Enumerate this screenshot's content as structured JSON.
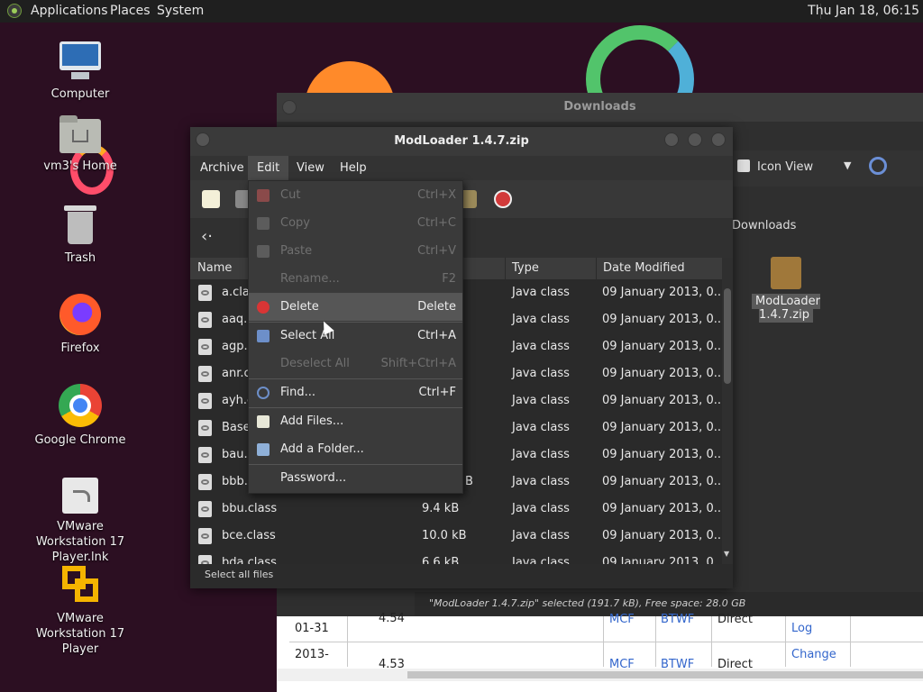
{
  "top_panel": {
    "menus": [
      "Applications",
      "Places",
      "System"
    ],
    "clock": "Thu Jan 18, 06:15"
  },
  "desktop_icons": [
    {
      "label": "Computer",
      "icon": "computer-icon"
    },
    {
      "label": "vm3's Home",
      "icon": "home-folder-icon"
    },
    {
      "label": "Trash",
      "icon": "trash-icon"
    },
    {
      "label": "Firefox",
      "icon": "firefox-icon"
    },
    {
      "label": "Google Chrome",
      "icon": "chrome-icon"
    },
    {
      "label": "VMware Workstation 17 Player.lnk",
      "icon": "shortcut-icon"
    },
    {
      "label": "VMware Workstation 17 Player",
      "icon": "vmware-icon"
    }
  ],
  "downloads_window": {
    "title": "Downloads",
    "view_mode": "Icon View",
    "path": "Downloads",
    "file_label": "ModLoader 1.4.7.zip",
    "status": "\"ModLoader 1.4.7.zip\" selected (191.7 kB), Free space: 28.0 GB"
  },
  "archive_window": {
    "title": "ModLoader 1.4.7.zip",
    "menus": [
      "Archive",
      "Edit",
      "View",
      "Help"
    ],
    "columns": {
      "name": "Name",
      "type": "Type",
      "date": "Date Modified"
    },
    "rows": [
      {
        "name": "a.clas",
        "size": "",
        "type": "Java class",
        "date": "09 January 2013, 0..."
      },
      {
        "name": "aaq.c",
        "size": "",
        "type": "Java class",
        "date": "09 January 2013, 0..."
      },
      {
        "name": "agp.c",
        "size": "",
        "type": "Java class",
        "date": "09 January 2013, 0..."
      },
      {
        "name": "anr.c",
        "size": "",
        "type": "Java class",
        "date": "09 January 2013, 0..."
      },
      {
        "name": "ayh.c",
        "size": "",
        "type": "Java class",
        "date": "09 January 2013, 0..."
      },
      {
        "name": "Base",
        "size": "",
        "type": "Java class",
        "date": "09 January 2013, 0..."
      },
      {
        "name": "bau.c",
        "size": "",
        "type": "Java class",
        "date": "09 January 2013, 0..."
      },
      {
        "name": "bbb.c",
        "size": "B",
        "type": "Java class",
        "date": "09 January 2013, 0..."
      },
      {
        "name": "bbu.class",
        "size": "9.4 kB",
        "type": "Java class",
        "date": "09 January 2013, 0..."
      },
      {
        "name": "bce.class",
        "size": "10.0 kB",
        "type": "Java class",
        "date": "09 January 2013, 0..."
      },
      {
        "name": "bda.class",
        "size": "6.6 kB",
        "type": "Java class",
        "date": "09 January 2013, 0..."
      }
    ],
    "status": "Select all files"
  },
  "edit_menu": [
    {
      "label": "Cut",
      "shortcut": "Ctrl+X",
      "disabled": true,
      "icon": "scissors-icon"
    },
    {
      "label": "Copy",
      "shortcut": "Ctrl+C",
      "disabled": true,
      "icon": "copy-icon"
    },
    {
      "label": "Paste",
      "shortcut": "Ctrl+V",
      "disabled": true,
      "icon": "paste-icon"
    },
    {
      "label": "Rename...",
      "shortcut": "F2",
      "disabled": true,
      "icon": ""
    },
    {
      "label": "Delete",
      "shortcut": "Delete",
      "disabled": false,
      "icon": "delete-icon"
    },
    {
      "label": "Select All",
      "shortcut": "Ctrl+A",
      "disabled": false,
      "icon": "select-all-icon"
    },
    {
      "label": "Deselect All",
      "shortcut": "Shift+Ctrl+A",
      "disabled": true,
      "icon": ""
    },
    {
      "label": "Find...",
      "shortcut": "Ctrl+F",
      "disabled": false,
      "icon": "find-icon"
    },
    {
      "label": "Add Files...",
      "shortcut": "",
      "disabled": false,
      "icon": "add-files-icon"
    },
    {
      "label": "Add a Folder...",
      "shortcut": "",
      "disabled": false,
      "icon": "add-folder-icon"
    },
    {
      "label": "Password...",
      "shortcut": "",
      "disabled": false,
      "icon": ""
    }
  ],
  "background_table": {
    "row1": {
      "c1": "01-31",
      "c2": "4.54",
      "c3": "MCF",
      "c4": "BTWF",
      "c5": "Direct",
      "c6": "Log"
    },
    "row2": {
      "c1": "2013-",
      "c2": "4.53",
      "c3": "MCF",
      "c4": "BTWF",
      "c5": "Direct",
      "c6": "Change"
    }
  }
}
